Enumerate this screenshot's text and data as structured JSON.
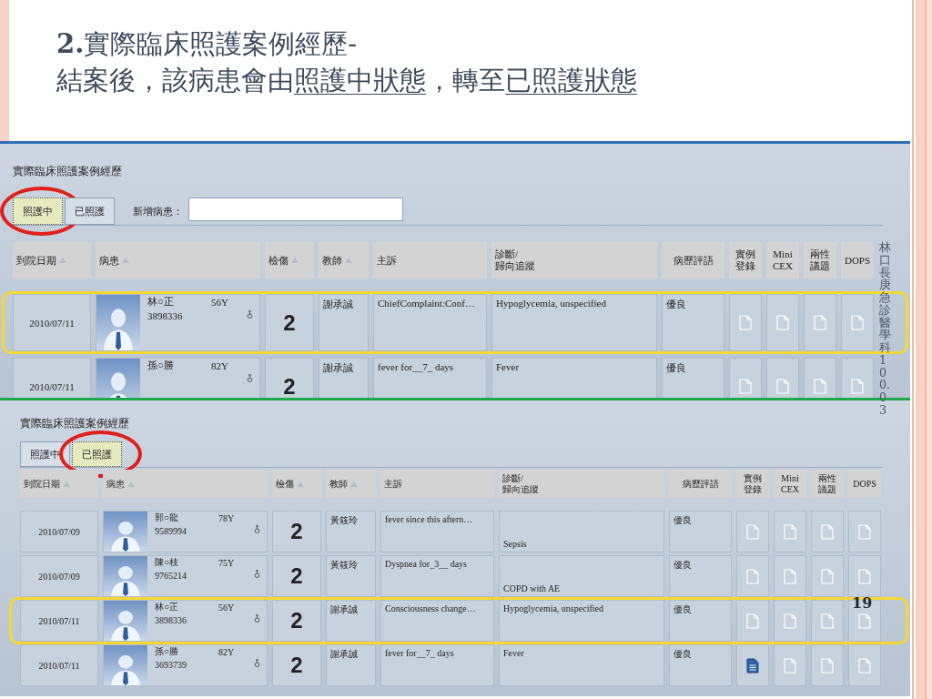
{
  "slide": {
    "title_lines": [
      [
        {
          "text": "**2.**實際臨床照護案例經歷-",
          "underlined": false
        }
      ],
      [
        {
          "text": "結案後，該病患會由",
          "underlined": false
        },
        {
          "text": "照護中狀態",
          "underlined": true
        },
        {
          "text": "，轉至",
          "underlined": false
        },
        {
          "text": "已照護狀態",
          "underlined": true
        }
      ]
    ],
    "side_note": "林口長庚急診醫學科100.03",
    "page_number": "19"
  },
  "panels": [
    {
      "heading": "實際臨床照護案例經歷",
      "tabs": [
        {
          "label": "照護中",
          "selected": true,
          "circled": true
        },
        {
          "label": "已照護",
          "selected": false,
          "circled": false
        }
      ],
      "new_patient": {
        "label": "新增病患："
      },
      "columns": [
        {
          "lines": [
            "到院日期"
          ],
          "sortable": true
        },
        {
          "lines": [
            "病患"
          ],
          "sortable": true
        },
        {
          "lines": [
            "檢傷"
          ],
          "sortable": true
        },
        {
          "lines": [
            "教師"
          ],
          "sortable": true
        },
        {
          "lines": [
            "主訴"
          ],
          "sortable": false
        },
        {
          "lines": [
            "診斷/",
            "歸向追蹤"
          ],
          "sortable": false
        },
        {
          "lines": [
            "病歷評語"
          ],
          "sortable": false
        },
        {
          "lines": [
            "實例",
            "登錄"
          ],
          "sortable": false
        },
        {
          "lines": [
            "Mini",
            "CEX"
          ],
          "sortable": false
        },
        {
          "lines": [
            "兩性",
            "議題"
          ],
          "sortable": false
        },
        {
          "lines": [
            "DOPS"
          ],
          "sortable": false
        }
      ],
      "rows": [
        {
          "date": "2010/07/11",
          "name": "林○正",
          "age": "56Y",
          "id": "3898336",
          "triage": "2",
          "teacher": "謝承誠",
          "complaint": "ChiefComplaint:Conf…",
          "diagnosis": "Hypoglycemia, unspecified",
          "diagnosis_at_bottom": false,
          "comment": "優良",
          "docs": [
            {
              "filled": false
            },
            {
              "filled": false
            },
            {
              "filled": false
            },
            {
              "filled": false
            }
          ],
          "highlighted": true
        },
        {
          "date": "2010/07/11",
          "name": "孫○勝",
          "age": "82Y",
          "triage": "2",
          "teacher": "謝承誠",
          "complaint": "fever for__7_ days",
          "diagnosis": "Fever",
          "diagnosis_at_bottom": false,
          "comment": "優良",
          "docs": [
            {
              "filled": false
            },
            {
              "filled": false
            },
            {
              "filled": false
            },
            {
              "filled": false
            }
          ],
          "highlighted": false
        }
      ]
    },
    {
      "heading": "實際臨床照護案例經歷",
      "tabs": [
        {
          "label": "照護中",
          "selected": false,
          "circled": false
        },
        {
          "label": "已照護",
          "selected": true,
          "circled": true
        }
      ],
      "columns": [
        {
          "lines": [
            "到院日期"
          ],
          "sortable": true
        },
        {
          "lines": [
            "病患"
          ],
          "sortable": true
        },
        {
          "lines": [
            "檢傷"
          ],
          "sortable": true
        },
        {
          "lines": [
            "教師"
          ],
          "sortable": true
        },
        {
          "lines": [
            "主訴"
          ],
          "sortable": false
        },
        {
          "lines": [
            "診斷/",
            "歸向追蹤"
          ],
          "sortable": false
        },
        {
          "lines": [
            "病歷評語"
          ],
          "sortable": false
        },
        {
          "lines": [
            "實例",
            "登錄"
          ],
          "sortable": false
        },
        {
          "lines": [
            "Mini",
            "CEX"
          ],
          "sortable": false
        },
        {
          "lines": [
            "兩性",
            "議題"
          ],
          "sortable": false
        },
        {
          "lines": [
            "DOPS"
          ],
          "sortable": false
        }
      ],
      "rows": [
        {
          "date": "2010/07/09",
          "name": "郭○龍",
          "age": "78Y",
          "id": "9589994",
          "triage": "2",
          "teacher": "黃筱玲",
          "complaint": "fever since this aftern…",
          "diagnosis": "Sepsis",
          "diagnosis_at_bottom": true,
          "comment": "優良",
          "docs": [
            {
              "filled": false
            },
            {
              "filled": false
            },
            {
              "filled": false
            },
            {
              "filled": false
            }
          ],
          "highlighted": false
        },
        {
          "date": "2010/07/09",
          "name": "陳○枝",
          "age": "75Y",
          "id": "9765214",
          "triage": "2",
          "teacher": "黃筱玲",
          "complaint": "Dyspnea for_3__ days",
          "diagnosis": "COPD with AE",
          "diagnosis_at_bottom": true,
          "comment": "優良",
          "docs": [
            {
              "filled": false
            },
            {
              "filled": false
            },
            {
              "filled": false
            },
            {
              "filled": false
            }
          ],
          "highlighted": false
        },
        {
          "date": "2010/07/11",
          "name": "林○正",
          "age": "56Y",
          "id": "3898336",
          "triage": "2",
          "teacher": "謝承誠",
          "complaint": "Consciousness change…",
          "diagnosis": "Hypoglycemia, unspecified",
          "diagnosis_at_bottom": false,
          "comment": "優良",
          "docs": [
            {
              "filled": false
            },
            {
              "filled": false
            },
            {
              "filled": false
            },
            {
              "filled": false
            }
          ],
          "highlighted": true
        },
        {
          "date": "2010/07/11",
          "name": "孫○勝",
          "age": "82Y",
          "id": "3693739",
          "triage": "2",
          "teacher": "謝承誠",
          "complaint": "fever for__7_ days",
          "diagnosis": "Fever",
          "diagnosis_at_bottom": false,
          "comment": "優良",
          "docs": [
            {
              "filled": true
            },
            {
              "filled": false
            },
            {
              "filled": false
            },
            {
              "filled": false
            }
          ],
          "highlighted": false
        }
      ]
    }
  ]
}
